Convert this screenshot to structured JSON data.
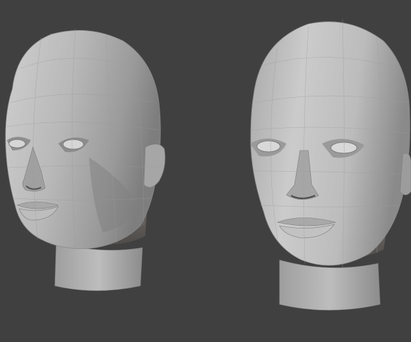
{
  "viewport": {
    "background_color": "#404040"
  },
  "models": [
    {
      "name": "head-mesh-left",
      "view": "three-quarter",
      "shading": "flat-faceted",
      "base_color": "#b3b3b3",
      "shadow_color": "#5e5a58"
    },
    {
      "name": "head-mesh-right",
      "view": "front",
      "shading": "flat-faceted",
      "base_color": "#b8b8b8",
      "shadow_color": "#5e5a58"
    }
  ]
}
